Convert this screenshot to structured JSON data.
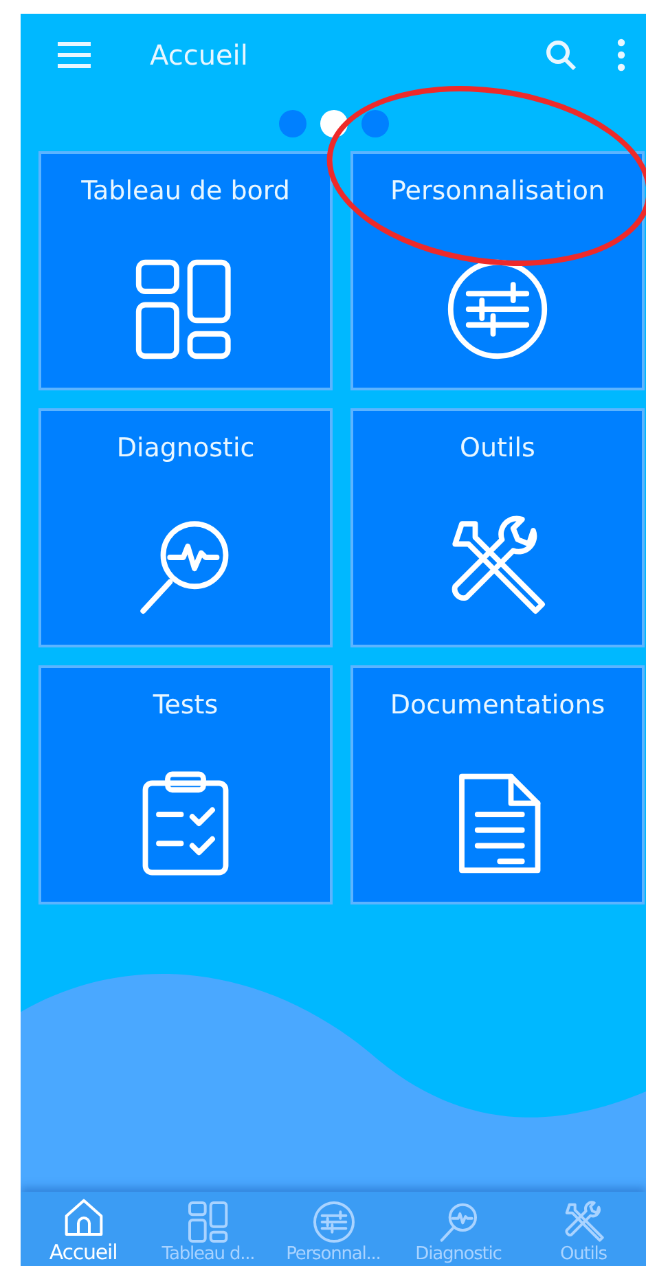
{
  "app_bar": {
    "title": "Accueil"
  },
  "pager": [
    {
      "selected": false
    },
    {
      "selected": true
    },
    {
      "selected": false
    }
  ],
  "tiles": [
    {
      "label": "Tableau de bord",
      "kind": "dashboard",
      "highlighted": false
    },
    {
      "label": "Personnalisation",
      "kind": "sliders",
      "highlighted": true
    },
    {
      "label": "Diagnostic",
      "kind": "diagnostic",
      "highlighted": false
    },
    {
      "label": "Outils",
      "kind": "tools",
      "highlighted": false
    },
    {
      "label": "Tests",
      "kind": "checklist",
      "highlighted": false
    },
    {
      "label": "Documentations",
      "kind": "document",
      "highlighted": false
    }
  ],
  "bottom_nav": [
    {
      "label": "Accueil",
      "kind": "home",
      "selected": true
    },
    {
      "label": "Tableau d...",
      "kind": "dashboard",
      "selected": false
    },
    {
      "label": "Personnal...",
      "kind": "sliders",
      "selected": false
    },
    {
      "label": "Diagnostic",
      "kind": "diagnostic",
      "selected": false
    },
    {
      "label": "Outils",
      "kind": "tools",
      "selected": false
    }
  ]
}
